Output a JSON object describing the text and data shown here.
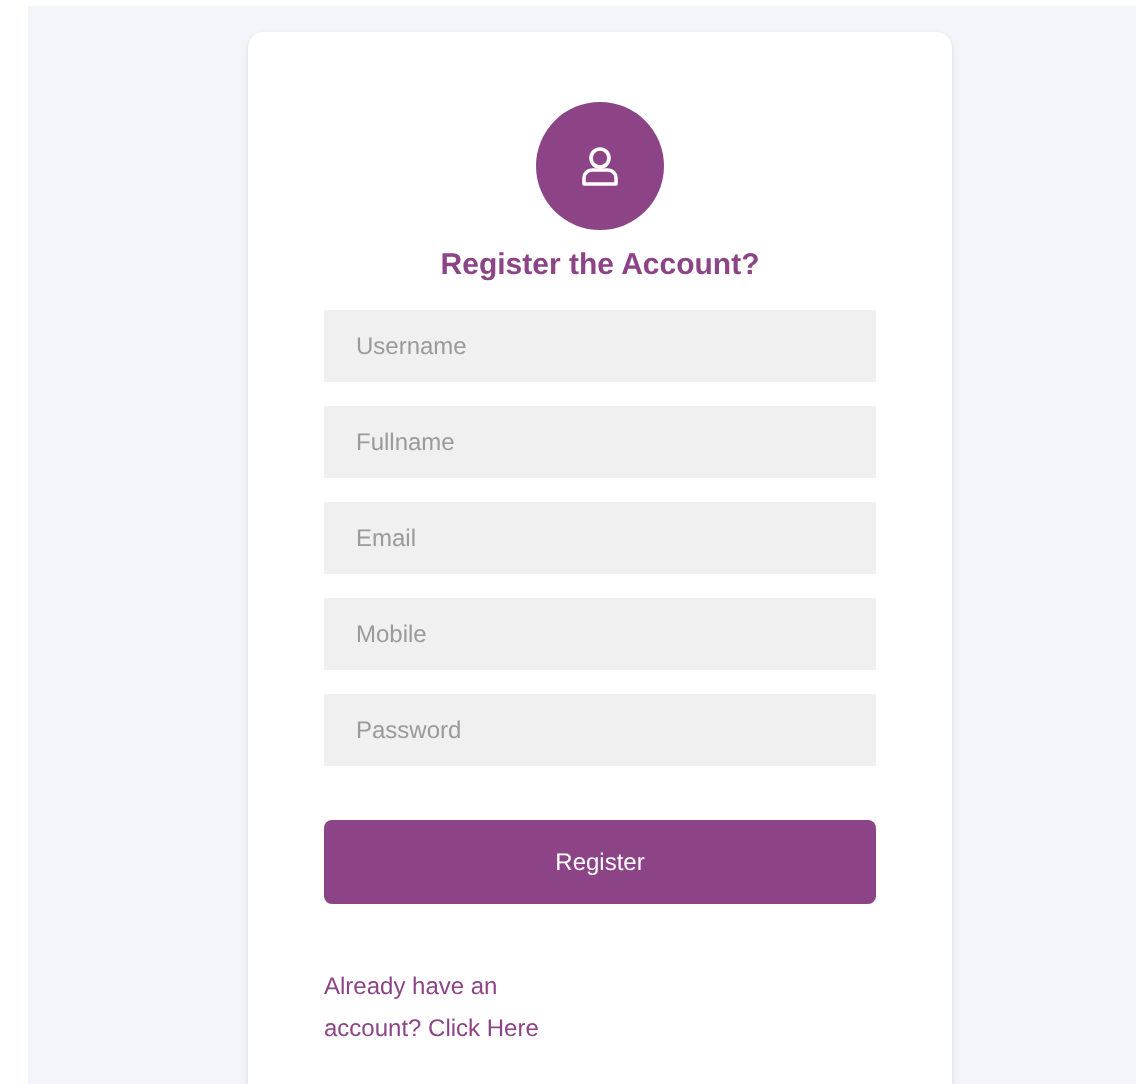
{
  "form": {
    "title": "Register the Account?",
    "fields": [
      {
        "placeholder": "Username"
      },
      {
        "placeholder": "Fullname"
      },
      {
        "placeholder": "Email"
      },
      {
        "placeholder": "Mobile"
      },
      {
        "placeholder": "Password"
      }
    ],
    "submit": "Register",
    "login_link": "Already have an account? Click Here"
  }
}
